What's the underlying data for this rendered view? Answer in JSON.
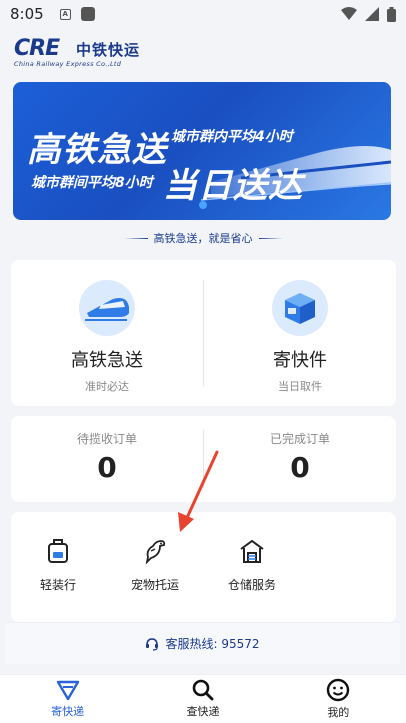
{
  "status_bar": {
    "time": "8:05",
    "notif_letter": "A"
  },
  "header": {
    "logo_cre": "CRE",
    "logo_cn": "中铁快运",
    "logo_en": "China Railway Express Co.,Ltd"
  },
  "banner": {
    "headline_1": "高铁急送",
    "sub_1": "城市群内平均4小时",
    "headline_2": "当日送达",
    "sub_2": "城市群间平均8小时"
  },
  "slogan": "高铁急送，就是省心",
  "services": [
    {
      "title": "高铁急送",
      "desc": "准时必达",
      "icon": "high-speed-train-icon"
    },
    {
      "title": "寄快件",
      "desc": "当日取件",
      "icon": "package-box-icon"
    }
  ],
  "orders": [
    {
      "label": "待揽收订单",
      "count": "0"
    },
    {
      "label": "已完成订单",
      "count": "0"
    }
  ],
  "tools": [
    {
      "label": "轻装行",
      "icon": "backpack-icon"
    },
    {
      "label": "宠物托运",
      "icon": "bird-icon"
    },
    {
      "label": "仓储服务",
      "icon": "warehouse-icon"
    }
  ],
  "hotline": {
    "text": "客服热线: 95572",
    "icon": "headset-icon"
  },
  "tabbar": [
    {
      "label": "寄快递",
      "icon": "send-icon",
      "active": true
    },
    {
      "label": "查快递",
      "icon": "search-icon",
      "active": false
    },
    {
      "label": "我的",
      "icon": "profile-face-icon",
      "active": false
    }
  ],
  "colors": {
    "primary": "#1b3a8c",
    "accent": "#2a62d9",
    "arrow": "#e8432e",
    "background": "#f2f4f7"
  }
}
